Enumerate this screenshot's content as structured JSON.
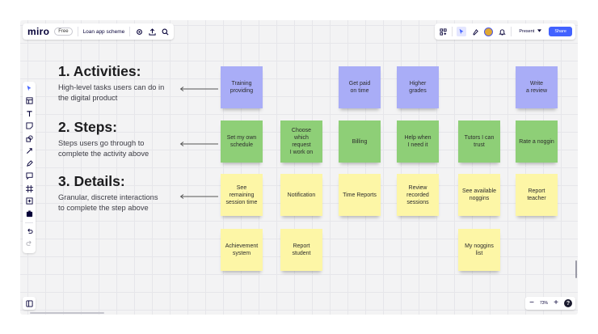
{
  "header": {
    "logo": "miro",
    "plan_badge": "Free",
    "board_name": "Loan app scheme",
    "present_label": "Present",
    "share_label": "Share"
  },
  "zoom": {
    "level": "73%",
    "minus": "−",
    "plus": "+",
    "help": "?"
  },
  "sections": [
    {
      "title": "1. Activities:",
      "desc": "High-level tasks users can do in\nthe digital product"
    },
    {
      "title": "2. Steps:",
      "desc": "Steps users go through to\ncomplete the activity above"
    },
    {
      "title": "3. Details:",
      "desc": "Granular, discrete interactions\nto complete the step above"
    }
  ],
  "stickies": {
    "activities": [
      "Training\nproviding",
      "Get paid\non time",
      "Higher\ngrades",
      "Write\na review"
    ],
    "steps": [
      "Set my own\nschedule",
      "Choose\nwhich\nrequest\nI work on",
      "Billing",
      "Help when\nI need it",
      "Tutors I can\ntrust",
      "Rate a noggin"
    ],
    "details_row1": [
      "See\nremaining\nsession time",
      "Notification",
      "Time Reports",
      "Review\nrecorded\nsessions",
      "See available\nnoggins",
      "Report\nteacher"
    ],
    "details_row2": [
      "Achievement\nsystem",
      "Report\nstudent",
      "My noggins\nlist"
    ]
  },
  "colors": {
    "activity": "#a9adf7",
    "step": "#8ecf77",
    "detail": "#fdf6a6",
    "share": "#4262ff"
  }
}
